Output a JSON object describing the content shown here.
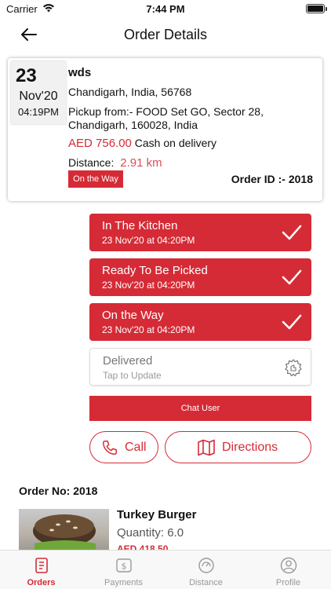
{
  "status_bar": {
    "carrier": "Carrier",
    "time": "7:44 PM"
  },
  "nav": {
    "title": "Order Details"
  },
  "order": {
    "day": "23",
    "month": "Nov'20",
    "time": "04:19PM",
    "customer": "wds",
    "address": "Chandigarh, India, 56768",
    "pickup": "Pickup from:- FOOD Set GO, Sector 28, Chandigarh, 160028, India",
    "price": "AED 756.00",
    "payment": "Cash on delivery",
    "distance_label": "Distance:",
    "distance_value": "2.91 km",
    "status": "On the Way",
    "order_id": "Order ID :- 2018"
  },
  "steps": [
    {
      "label": "In The Kitchen",
      "time": "23 Nov'20 at 04:20PM",
      "state": "done"
    },
    {
      "label": "Ready To Be Picked",
      "time": "23 Nov'20 at 04:20PM",
      "state": "done"
    },
    {
      "label": "On the Way",
      "time": "23 Nov'20 at 04:20PM",
      "state": "done"
    },
    {
      "label": "Delivered",
      "time": "Tap to Update",
      "state": "pending"
    }
  ],
  "actions": {
    "chat": "Chat User",
    "call": "Call",
    "directions": "Directions"
  },
  "items_section": {
    "order_no": "Order No: 2018",
    "items": [
      {
        "name": "Turkey Burger",
        "quantity": "Quantity: 6.0",
        "price": "AED 418.50"
      }
    ]
  },
  "tabs": [
    {
      "label": "Orders",
      "icon": "orders-icon",
      "active": true
    },
    {
      "label": "Payments",
      "icon": "payments-icon",
      "active": false
    },
    {
      "label": "Distance",
      "icon": "distance-icon",
      "active": false
    },
    {
      "label": "Profile",
      "icon": "profile-icon",
      "active": false
    }
  ],
  "colors": {
    "accent": "#d52b36",
    "inactive": "#999999"
  }
}
